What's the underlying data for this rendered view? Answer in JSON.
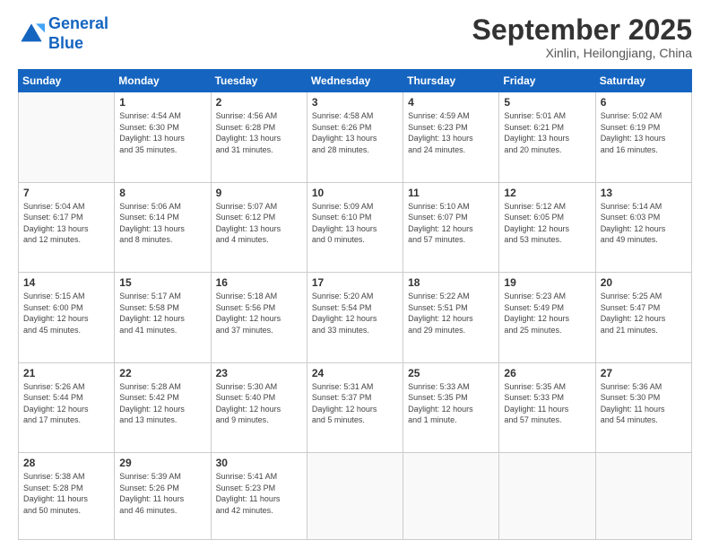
{
  "header": {
    "logo_line1": "General",
    "logo_line2": "Blue",
    "month": "September 2025",
    "location": "Xinlin, Heilongjiang, China"
  },
  "weekdays": [
    "Sunday",
    "Monday",
    "Tuesday",
    "Wednesday",
    "Thursday",
    "Friday",
    "Saturday"
  ],
  "weeks": [
    [
      {
        "day": "",
        "info": ""
      },
      {
        "day": "1",
        "info": "Sunrise: 4:54 AM\nSunset: 6:30 PM\nDaylight: 13 hours\nand 35 minutes."
      },
      {
        "day": "2",
        "info": "Sunrise: 4:56 AM\nSunset: 6:28 PM\nDaylight: 13 hours\nand 31 minutes."
      },
      {
        "day": "3",
        "info": "Sunrise: 4:58 AM\nSunset: 6:26 PM\nDaylight: 13 hours\nand 28 minutes."
      },
      {
        "day": "4",
        "info": "Sunrise: 4:59 AM\nSunset: 6:23 PM\nDaylight: 13 hours\nand 24 minutes."
      },
      {
        "day": "5",
        "info": "Sunrise: 5:01 AM\nSunset: 6:21 PM\nDaylight: 13 hours\nand 20 minutes."
      },
      {
        "day": "6",
        "info": "Sunrise: 5:02 AM\nSunset: 6:19 PM\nDaylight: 13 hours\nand 16 minutes."
      }
    ],
    [
      {
        "day": "7",
        "info": "Sunrise: 5:04 AM\nSunset: 6:17 PM\nDaylight: 13 hours\nand 12 minutes."
      },
      {
        "day": "8",
        "info": "Sunrise: 5:06 AM\nSunset: 6:14 PM\nDaylight: 13 hours\nand 8 minutes."
      },
      {
        "day": "9",
        "info": "Sunrise: 5:07 AM\nSunset: 6:12 PM\nDaylight: 13 hours\nand 4 minutes."
      },
      {
        "day": "10",
        "info": "Sunrise: 5:09 AM\nSunset: 6:10 PM\nDaylight: 13 hours\nand 0 minutes."
      },
      {
        "day": "11",
        "info": "Sunrise: 5:10 AM\nSunset: 6:07 PM\nDaylight: 12 hours\nand 57 minutes."
      },
      {
        "day": "12",
        "info": "Sunrise: 5:12 AM\nSunset: 6:05 PM\nDaylight: 12 hours\nand 53 minutes."
      },
      {
        "day": "13",
        "info": "Sunrise: 5:14 AM\nSunset: 6:03 PM\nDaylight: 12 hours\nand 49 minutes."
      }
    ],
    [
      {
        "day": "14",
        "info": "Sunrise: 5:15 AM\nSunset: 6:00 PM\nDaylight: 12 hours\nand 45 minutes."
      },
      {
        "day": "15",
        "info": "Sunrise: 5:17 AM\nSunset: 5:58 PM\nDaylight: 12 hours\nand 41 minutes."
      },
      {
        "day": "16",
        "info": "Sunrise: 5:18 AM\nSunset: 5:56 PM\nDaylight: 12 hours\nand 37 minutes."
      },
      {
        "day": "17",
        "info": "Sunrise: 5:20 AM\nSunset: 5:54 PM\nDaylight: 12 hours\nand 33 minutes."
      },
      {
        "day": "18",
        "info": "Sunrise: 5:22 AM\nSunset: 5:51 PM\nDaylight: 12 hours\nand 29 minutes."
      },
      {
        "day": "19",
        "info": "Sunrise: 5:23 AM\nSunset: 5:49 PM\nDaylight: 12 hours\nand 25 minutes."
      },
      {
        "day": "20",
        "info": "Sunrise: 5:25 AM\nSunset: 5:47 PM\nDaylight: 12 hours\nand 21 minutes."
      }
    ],
    [
      {
        "day": "21",
        "info": "Sunrise: 5:26 AM\nSunset: 5:44 PM\nDaylight: 12 hours\nand 17 minutes."
      },
      {
        "day": "22",
        "info": "Sunrise: 5:28 AM\nSunset: 5:42 PM\nDaylight: 12 hours\nand 13 minutes."
      },
      {
        "day": "23",
        "info": "Sunrise: 5:30 AM\nSunset: 5:40 PM\nDaylight: 12 hours\nand 9 minutes."
      },
      {
        "day": "24",
        "info": "Sunrise: 5:31 AM\nSunset: 5:37 PM\nDaylight: 12 hours\nand 5 minutes."
      },
      {
        "day": "25",
        "info": "Sunrise: 5:33 AM\nSunset: 5:35 PM\nDaylight: 12 hours\nand 1 minute."
      },
      {
        "day": "26",
        "info": "Sunrise: 5:35 AM\nSunset: 5:33 PM\nDaylight: 11 hours\nand 57 minutes."
      },
      {
        "day": "27",
        "info": "Sunrise: 5:36 AM\nSunset: 5:30 PM\nDaylight: 11 hours\nand 54 minutes."
      }
    ],
    [
      {
        "day": "28",
        "info": "Sunrise: 5:38 AM\nSunset: 5:28 PM\nDaylight: 11 hours\nand 50 minutes."
      },
      {
        "day": "29",
        "info": "Sunrise: 5:39 AM\nSunset: 5:26 PM\nDaylight: 11 hours\nand 46 minutes."
      },
      {
        "day": "30",
        "info": "Sunrise: 5:41 AM\nSunset: 5:23 PM\nDaylight: 11 hours\nand 42 minutes."
      },
      {
        "day": "",
        "info": ""
      },
      {
        "day": "",
        "info": ""
      },
      {
        "day": "",
        "info": ""
      },
      {
        "day": "",
        "info": ""
      }
    ]
  ]
}
